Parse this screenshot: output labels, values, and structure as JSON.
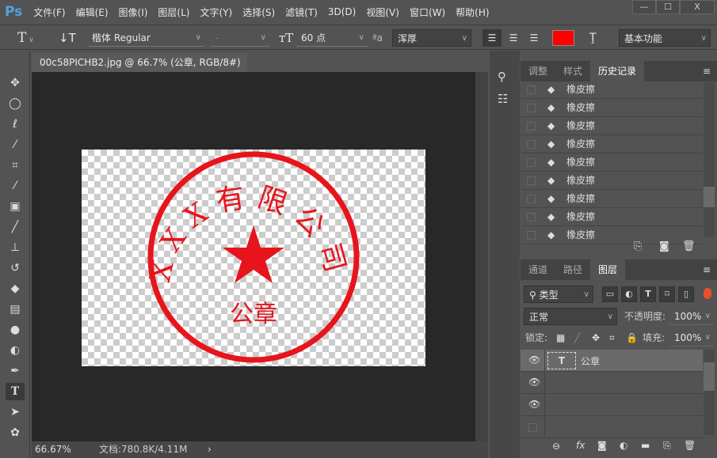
{
  "app": {
    "logo": "Ps"
  },
  "menu": [
    "文件(F)",
    "编辑(E)",
    "图像(I)",
    "图层(L)",
    "文字(Y)",
    "选择(S)",
    "滤镜(T)",
    "3D(D)",
    "视图(V)",
    "窗口(W)",
    "帮助(H)"
  ],
  "window": {
    "minimize": "—",
    "maximize": "☐",
    "close": "X"
  },
  "options": {
    "font_family": "楷体 Regular",
    "font_style": "-",
    "font_size": "60 点",
    "antialias": "浑厚",
    "text_color": "#ff0000",
    "workspace": "基本功能"
  },
  "document": {
    "tab_title": "00c58PICHB2.jpg @ 66.7% (公章, RGB/8#) *",
    "close": "×"
  },
  "stamp": {
    "company": "XXX有限公司",
    "label": "公章",
    "color": "#e8141c"
  },
  "status": {
    "zoom": "66.67%",
    "doc_info": "文档:780.8K/4.11M",
    "arrow": "›"
  },
  "history": {
    "tabs": [
      "调整",
      "样式",
      "历史记录"
    ],
    "items": [
      "橡皮擦",
      "橡皮擦",
      "橡皮擦",
      "橡皮擦",
      "橡皮擦",
      "橡皮擦",
      "橡皮擦",
      "橡皮擦",
      "橡皮擦"
    ]
  },
  "layers": {
    "tabs": [
      "通道",
      "路径",
      "图层"
    ],
    "filter": "类型",
    "blend": "正常",
    "opacity_label": "不透明度:",
    "opacity": "100%",
    "lock_label": "锁定:",
    "fill_label": "填充:",
    "fill": "100%",
    "items": [
      {
        "name": "公章",
        "type": "T",
        "visible": true
      },
      {
        "name": "",
        "visible": true
      },
      {
        "name": "",
        "visible": true
      },
      {
        "name": "",
        "visible": false
      }
    ]
  }
}
